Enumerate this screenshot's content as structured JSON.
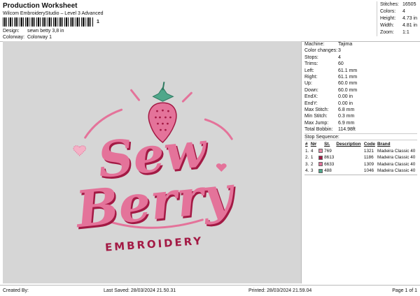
{
  "header": {
    "title": "Production Worksheet",
    "subtitle": "Wilcom EmbroideryStudio – Level 3 Advanced",
    "barcode_number": "1"
  },
  "design": {
    "design_label": "Design:",
    "design_value": "sewn betty 3,8 in",
    "colorway_label": "Colorway:",
    "colorway_value": "Colorway 1"
  },
  "summary": [
    {
      "label": "Stitches:",
      "value": "16505"
    },
    {
      "label": "Colors:",
      "value": "4"
    },
    {
      "label": "Height:",
      "value": "4.73 in"
    },
    {
      "label": "Width:",
      "value": "4.81 in"
    },
    {
      "label": "Zoom:",
      "value": "1:1"
    }
  ],
  "machine_info": [
    {
      "label": "Machine:",
      "value": "Tajima"
    },
    {
      "label": "Color changes:",
      "value": "3"
    },
    {
      "label": "Stops:",
      "value": "4"
    },
    {
      "label": "Trims:",
      "value": "60"
    },
    {
      "label": "Left:",
      "value": "61.1 mm"
    },
    {
      "label": "Right:",
      "value": "61.1 mm"
    },
    {
      "label": "Up:",
      "value": "60.0 mm"
    },
    {
      "label": "Down:",
      "value": "60.0 mm"
    },
    {
      "label": "EndX:",
      "value": "0.00 in"
    },
    {
      "label": "EndY:",
      "value": "0.00 in"
    },
    {
      "label": "Max Stitch:",
      "value": "6.8 mm"
    },
    {
      "label": "Min Stitch:",
      "value": "0.3 mm"
    },
    {
      "label": "Max Jump:",
      "value": "6.9 mm"
    },
    {
      "label": "Total Bobbin:",
      "value": "114.98ft"
    }
  ],
  "stop_sequence": {
    "label": "Stop Sequence:",
    "columns": [
      "#",
      "N#",
      "",
      "St.",
      "Description",
      "Code",
      "Brand"
    ],
    "rows": [
      {
        "num": "1.",
        "n": "4",
        "color": "#e48aa6",
        "st": "769",
        "desc": "",
        "code": "1321",
        "brand": "Madeira Classic 40"
      },
      {
        "num": "2.",
        "n": "1",
        "color": "#a31944",
        "st": "8613",
        "desc": "",
        "code": "1186",
        "brand": "Madeira Classic 40"
      },
      {
        "num": "3.",
        "n": "2",
        "color": "#e0729a",
        "st": "6633",
        "desc": "",
        "code": "1309",
        "brand": "Madeira Classic 40"
      },
      {
        "num": "4.",
        "n": "3",
        "color": "#4fa78a",
        "st": "488",
        "desc": "",
        "code": "1046",
        "brand": "Madeira Classic 40"
      }
    ]
  },
  "artwork": {
    "word1": "Sew",
    "word2": "Berry",
    "tagline": "EMBROIDERY",
    "colors": {
      "main": "#e4739a",
      "dark": "#a31944",
      "light": "#f4b1c6",
      "leaf": "#4fa78a",
      "bg": "#d6d6d6"
    }
  },
  "footer": {
    "created_by": "Created By:",
    "last_saved": "Last Saved: 28/03/2024 21.50.31",
    "printed": "Printed: 28/03/2024 21.59.04",
    "page": "Page 1 of 1"
  }
}
